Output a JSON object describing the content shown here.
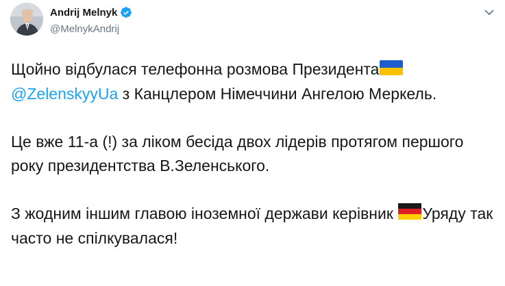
{
  "author": {
    "name": "Andrij Melnyk",
    "handle": "@MelnykAndrij",
    "verified": true
  },
  "tweet": {
    "p1_text1": "Щойно відбулася телефонна розмова Президента",
    "p1_flag": "ukraine-flag-icon",
    "p1_mention": "@ZelenskyyUa",
    "p1_text2": " з Канцлером Німеччини Ангелою Меркель.",
    "p2_text": "Це вже 11-а (!) за ліком бесіда двох лідерів протягом першого року президентства В.Зеленського.",
    "p3_text1": "З жодним іншим главою іноземної держави керівник ",
    "p3_flag": "germany-flag-icon",
    "p3_text2": "Уряду так часто не спілкувалася!"
  },
  "colors": {
    "link": "#1da1f2",
    "text": "#14171a",
    "secondary": "#657786",
    "verified": "#1da1f2"
  },
  "icons": {
    "caret": "chevron-down-icon",
    "verified": "verified-badge-icon"
  }
}
